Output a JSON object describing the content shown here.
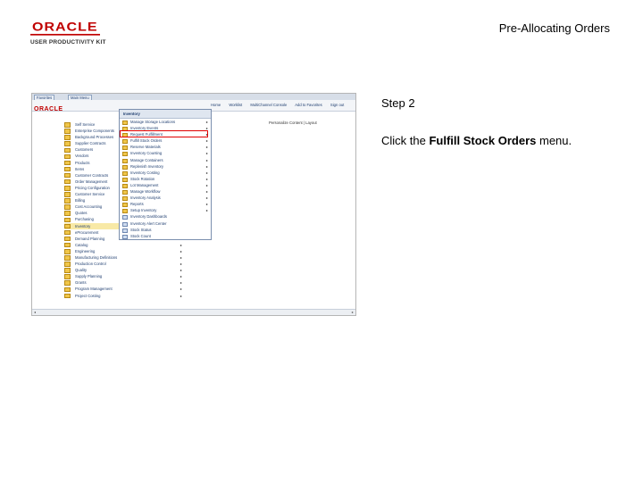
{
  "header": {
    "logo_brand": "ORACLE",
    "logo_product": "USER PRODUCTIVITY KIT",
    "title": "Pre-Allocating Orders"
  },
  "step": {
    "label": "Step 2",
    "instruction_prefix": "Click the ",
    "instruction_bold": "Fulfill Stock Orders",
    "instruction_suffix": " menu."
  },
  "screenshot": {
    "tabs": [
      "Favorites",
      "Main Menu"
    ],
    "nav_links": [
      "Home",
      "Worklist",
      "MultiChannel Console",
      "Add to Favorites",
      "Sign out"
    ],
    "mini_logo": "ORACLE",
    "personalize": "Personalize Content | Layout",
    "submenu_header": "Inventory",
    "left_items": [
      {
        "label": "Self Service",
        "arrow": true,
        "highlight": false
      },
      {
        "label": "Enterprise Components",
        "arrow": true,
        "highlight": false
      },
      {
        "label": "Background Processes",
        "arrow": true,
        "highlight": false
      },
      {
        "label": "Supplier Contracts",
        "arrow": true,
        "highlight": false
      },
      {
        "label": "Customers",
        "arrow": true,
        "highlight": false
      },
      {
        "label": "Vendors",
        "arrow": true,
        "highlight": false
      },
      {
        "label": "Products",
        "arrow": true,
        "highlight": false
      },
      {
        "label": "Items",
        "arrow": true,
        "highlight": false
      },
      {
        "label": "Customer Contracts",
        "arrow": true,
        "highlight": false
      },
      {
        "label": "Order Management",
        "arrow": true,
        "highlight": false
      },
      {
        "label": "Pricing Configuration",
        "arrow": true,
        "highlight": false
      },
      {
        "label": "Customer Service",
        "arrow": true,
        "highlight": false
      },
      {
        "label": "Billing",
        "arrow": true,
        "highlight": false
      },
      {
        "label": "Cost Accounting",
        "arrow": true,
        "highlight": false
      },
      {
        "label": "Quotes",
        "arrow": true,
        "highlight": false
      },
      {
        "label": "Purchasing",
        "arrow": true,
        "highlight": false
      },
      {
        "label": "Inventory",
        "arrow": true,
        "highlight": true
      },
      {
        "label": "eProcurement",
        "arrow": true,
        "highlight": false
      },
      {
        "label": "Demand Planning",
        "arrow": true,
        "highlight": false
      },
      {
        "label": "Catalog",
        "arrow": true,
        "highlight": false
      },
      {
        "label": "Engineering",
        "arrow": true,
        "highlight": false
      },
      {
        "label": "Manufacturing Definitions",
        "arrow": true,
        "highlight": false
      },
      {
        "label": "Production Control",
        "arrow": true,
        "highlight": false
      },
      {
        "label": "Quality",
        "arrow": true,
        "highlight": false
      },
      {
        "label": "Supply Planning",
        "arrow": true,
        "highlight": false
      },
      {
        "label": "Grants",
        "arrow": true,
        "highlight": false
      },
      {
        "label": "Program Management",
        "arrow": true,
        "highlight": false
      },
      {
        "label": "Project Costing",
        "arrow": true,
        "highlight": false
      }
    ],
    "menu_items": [
      {
        "label": "Manage Storage Locations",
        "arrow": true,
        "doc": false
      },
      {
        "label": "Inventory Events",
        "arrow": true,
        "doc": false
      },
      {
        "label": "Request Fulfillment",
        "arrow": true,
        "doc": false
      },
      {
        "label": "Fulfill Stock Orders",
        "arrow": true,
        "doc": false
      },
      {
        "label": "Reserve Materials",
        "arrow": true,
        "doc": false
      },
      {
        "label": "Inventory Counting",
        "arrow": true,
        "doc": false
      },
      {
        "label": "Manage Containers",
        "arrow": true,
        "doc": false
      },
      {
        "label": "Replenish Inventory",
        "arrow": true,
        "doc": false
      },
      {
        "label": "Inventory Costing",
        "arrow": true,
        "doc": false
      },
      {
        "label": "Stock Rotation",
        "arrow": true,
        "doc": false
      },
      {
        "label": "Lot Management",
        "arrow": true,
        "doc": false
      },
      {
        "label": "Manage Workflow",
        "arrow": true,
        "doc": false
      },
      {
        "label": "Inventory Analysis",
        "arrow": true,
        "doc": false
      },
      {
        "label": "Reports",
        "arrow": true,
        "doc": false
      },
      {
        "label": "Setup Inventory",
        "arrow": true,
        "doc": false
      },
      {
        "label": "Inventory Dashboards",
        "arrow": false,
        "doc": true
      },
      {
        "label": "Inventory Alert Center",
        "arrow": false,
        "doc": true
      },
      {
        "label": "Stock Status",
        "arrow": false,
        "doc": true
      },
      {
        "label": "Stock Count",
        "arrow": false,
        "doc": true
      }
    ],
    "accent_red": "#e00000"
  }
}
